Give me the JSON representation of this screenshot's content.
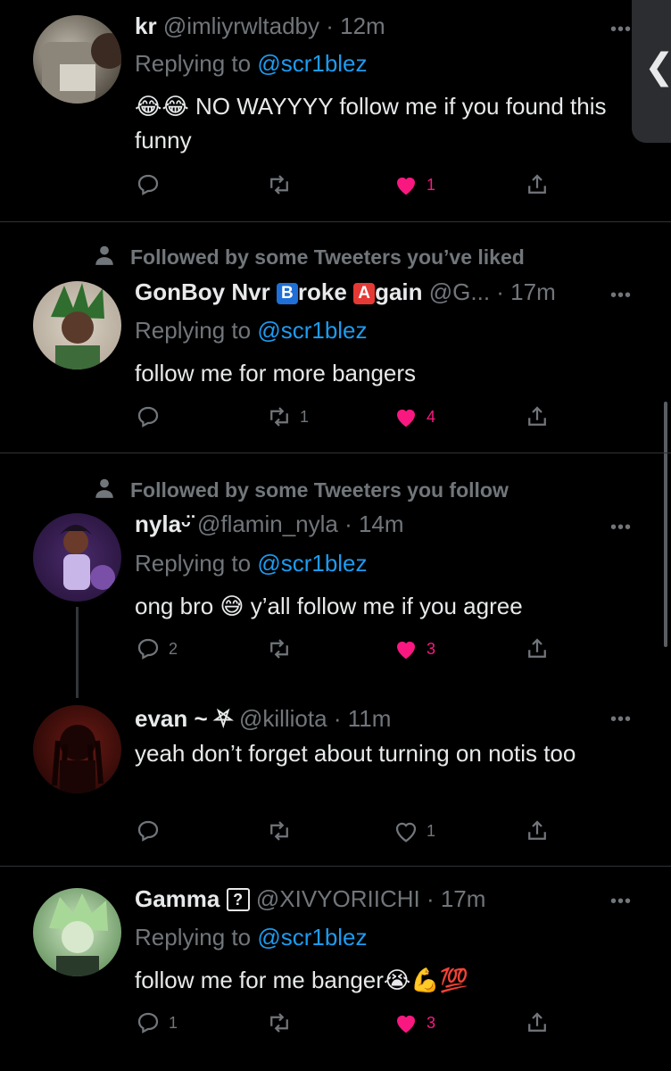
{
  "tweets": [
    {
      "name": "kr",
      "handle": "@imliyrwltadby",
      "time": "· 12m",
      "reply_prefix": "Replying to",
      "reply_to": "@scr1blez",
      "text": "NO WAYYYY follow me if you found this funny",
      "emoji": "😂😂",
      "replies": "",
      "retweets": "",
      "likes": "1",
      "liked": true
    },
    {
      "social": "Followed by some Tweeters you’ve liked",
      "name_a": "GonBoy Nvr",
      "name_badge1": "B",
      "name_b": "roke",
      "name_badge2": "A",
      "name_c": "gain",
      "handle": "@G...",
      "time": "· 17m",
      "reply_prefix": "Replying to",
      "reply_to": "@scr1blez",
      "text": "follow me for more bangers",
      "replies": "",
      "retweets": "1",
      "likes": "4",
      "liked": true
    },
    {
      "social": "Followed by some Tweeters you follow",
      "name": "nyla",
      "name_suffix": "ᵕ̈",
      "handle": "@flamin_nyla",
      "time": "· 14m",
      "reply_prefix": "Replying to",
      "reply_to": "@scr1blez",
      "text_a": "ong bro",
      "emoji": "😅",
      "text_b": "y’all follow me if you agree",
      "replies": "2",
      "retweets": "",
      "likes": "3",
      "liked": true
    },
    {
      "name": "evan ~ ⛧",
      "handle": "@killiota",
      "time": "· 11m",
      "text": "yeah don’t forget about turning on notis too",
      "replies": "",
      "retweets": "",
      "likes": "1",
      "liked": false
    },
    {
      "name": "Gamma",
      "name_badge": "?",
      "handle": "@XIVYORIICHI",
      "time": "· 17m",
      "reply_prefix": "Replying to",
      "reply_to": "@scr1blez",
      "text": "follow me for me banger",
      "emoji": "😭💪💯",
      "replies": "1",
      "retweets": "",
      "likes": "3",
      "liked": true
    }
  ],
  "more_glyph": "•••",
  "side_handle_glyph": "❮",
  "colors": {
    "background": "#000000",
    "text": "#e7e9ea",
    "muted": "#71767b",
    "link": "#1d9bf0",
    "like": "#f91880",
    "divider": "#2f3336"
  },
  "icons": [
    "reply-icon",
    "retweet-icon",
    "like-icon",
    "share-icon",
    "person-icon",
    "more-icon"
  ]
}
